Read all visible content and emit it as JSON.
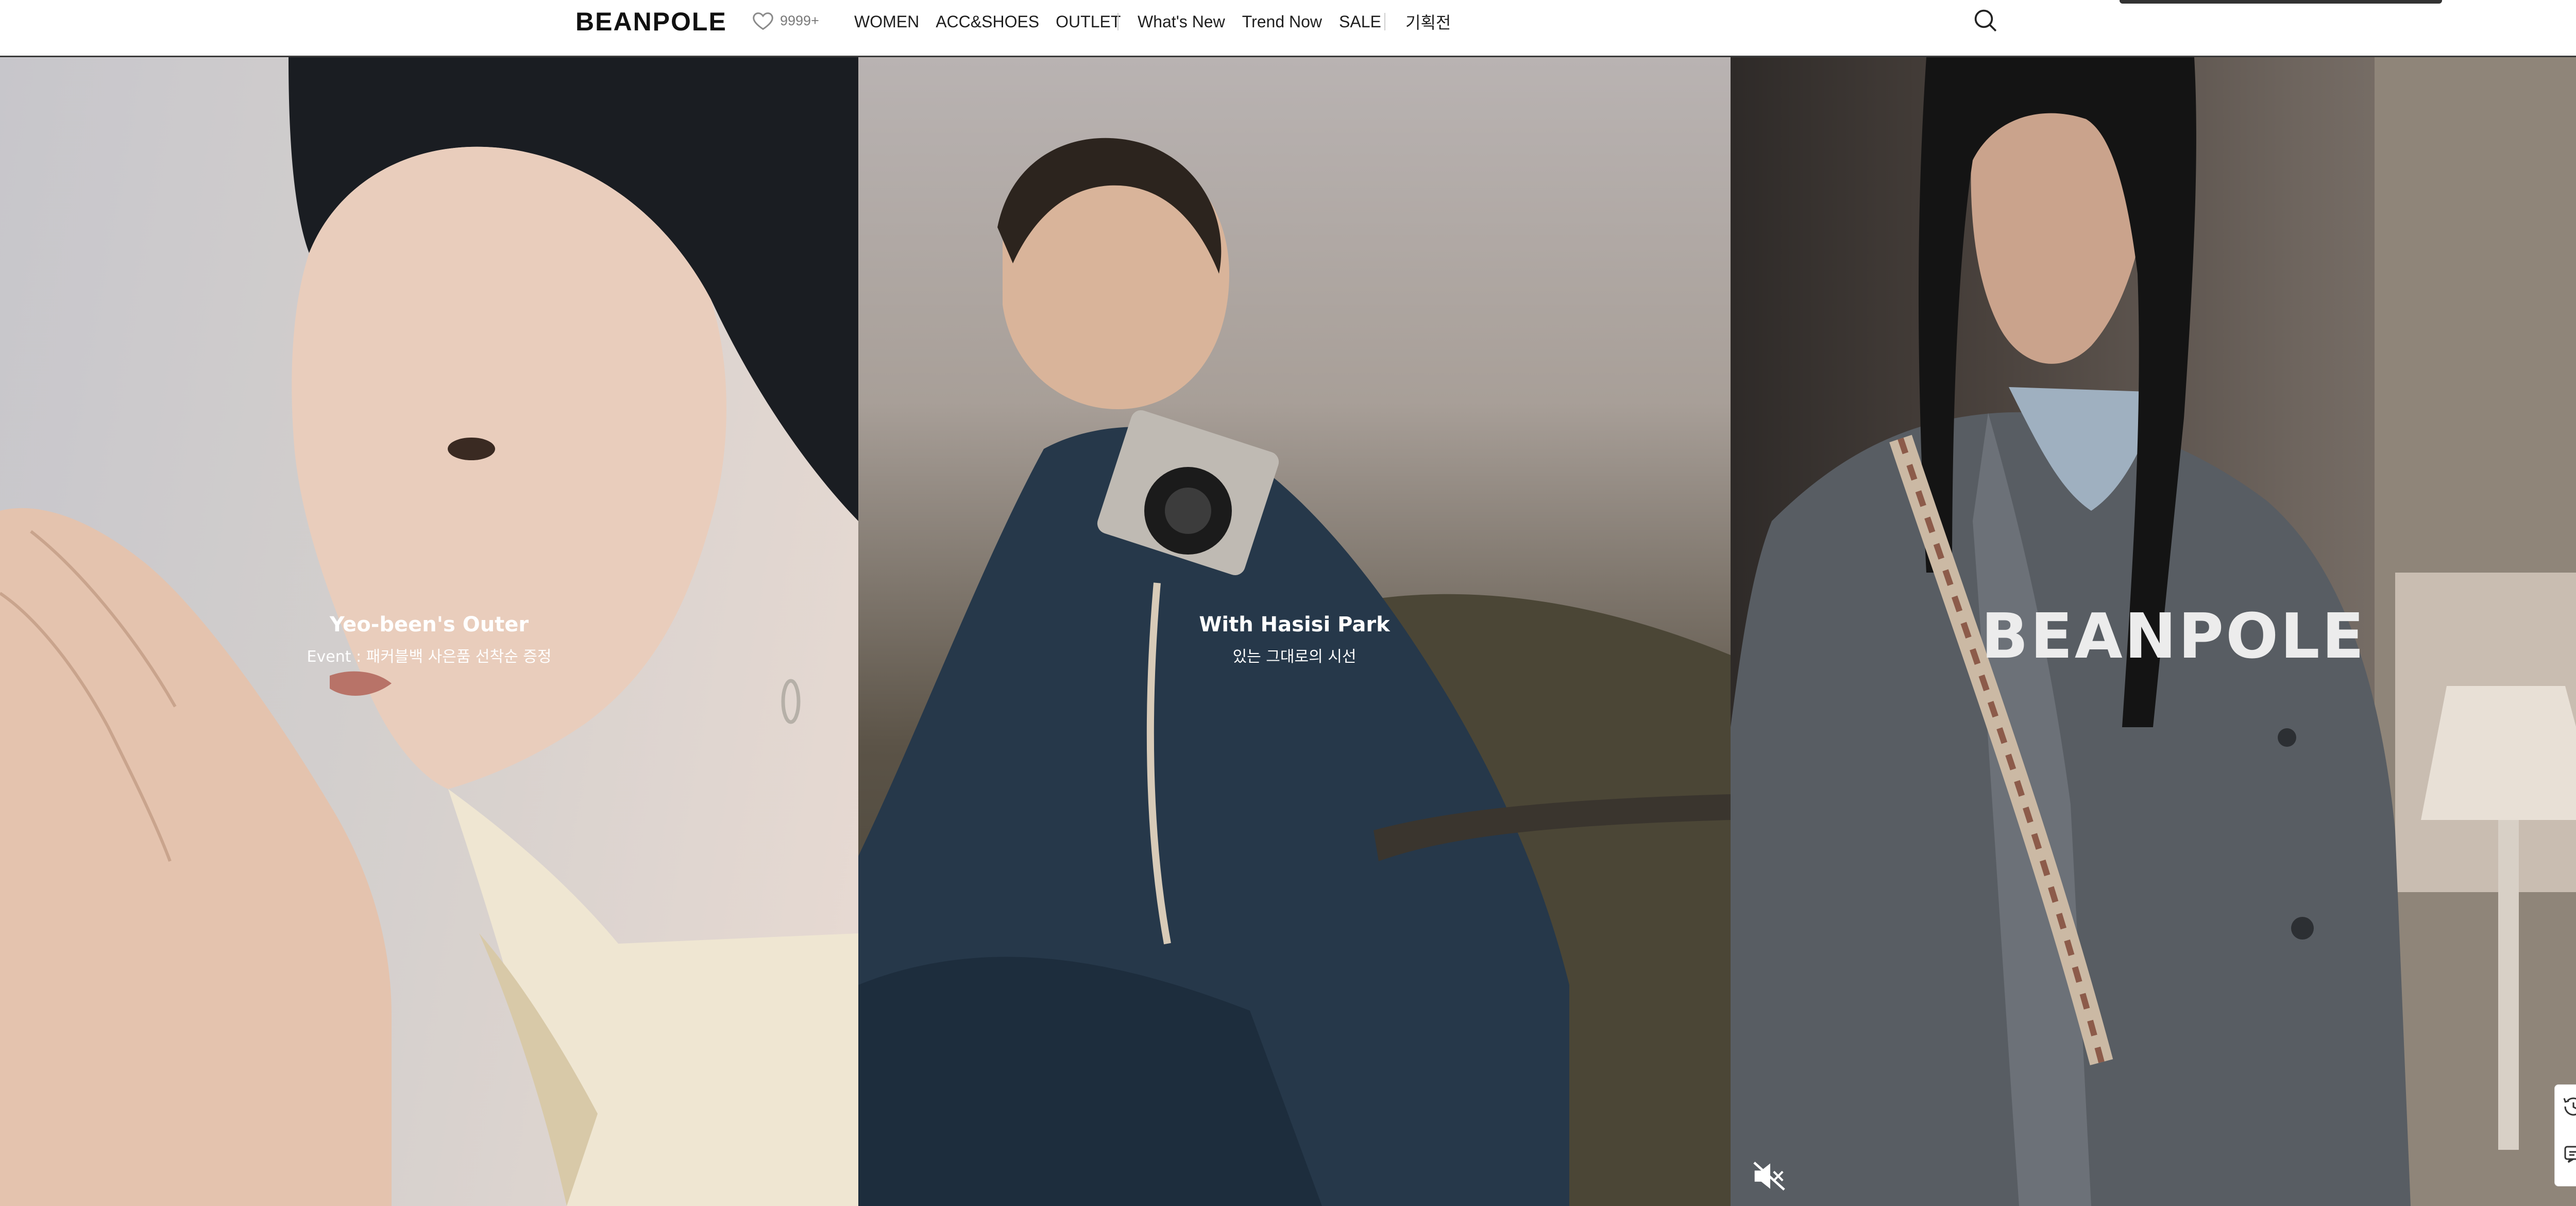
{
  "header": {
    "logo": "BEANPOLE",
    "wishlist_count": "9999+",
    "nav_primary": [
      "WOMEN",
      "ACC&SHOES",
      "OUTLET"
    ],
    "nav_secondary": [
      "What's New",
      "Trend Now",
      "SALE"
    ],
    "nav_special": "기획전"
  },
  "panels": [
    {
      "title": "Yeo-been's Outer",
      "subtitle": "Event : 패커블백 사은품 선착순 증정"
    },
    {
      "title": "With Hasisi Park",
      "subtitle": "있는 그대로의 시선"
    },
    {
      "overlay_logo": "BEANPOLE"
    }
  ],
  "icons": {
    "wishlist": "heart-icon",
    "search": "search-icon",
    "mute": "speaker-muted-icon",
    "recent": "history-icon",
    "chat": "chat-icon"
  },
  "colors": {
    "header_bg": "#ffffff",
    "header_border": "#3a3a3a",
    "caption_text": "#ffffff",
    "wish_count": "#7a7a7a"
  }
}
